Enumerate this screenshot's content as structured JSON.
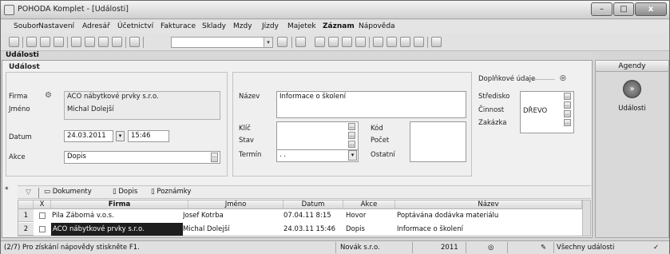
{
  "window": {
    "title": "POHODA Komplet - [Události]",
    "controls": {
      "minimize": "–",
      "maximize": "□",
      "close": "x"
    }
  },
  "menu": [
    "Soubor",
    "Nastavení",
    "Adresář",
    "Účetnictví",
    "Fakturace",
    "Sklady",
    "Mzdy",
    "Jízdy",
    "Majetek",
    "Záznam",
    "Nápověda"
  ],
  "panel": {
    "title": "Události"
  },
  "form": {
    "section_title": "Událost",
    "firma_label": "Firma",
    "firma_value": "ACO nábytkové prvky s.r.o.",
    "jmeno_label": "Jméno",
    "jmeno_value": "Michal Dolejší",
    "datum_label": "Datum",
    "datum_value": "24.03.2011",
    "cas_value": "15:46",
    "akce_label": "Akce",
    "akce_value": "Dopis",
    "nazev_label": "Název",
    "nazev_value": "Informace o školení",
    "klic_label": "Klíč",
    "stav_label": "Stav",
    "termin_label": "Termín",
    "termin_value": ". .",
    "kod_label": "Kód",
    "pocet_label": "Počet",
    "ostatni_label": "Ostatní",
    "doplnkove_label": "Doplňkové údaje",
    "stredisko_label": "Středisko",
    "cinnost_label": "Činnost",
    "cinnost_value": "DŘEVO",
    "zakazka_label": "Zakázka"
  },
  "tabs": [
    "Dokumenty",
    "Dopis",
    "Poznámky"
  ],
  "grid": {
    "columns": [
      "X",
      "Firma",
      "Jméno",
      "Datum",
      "Akce",
      "Název"
    ],
    "rows": [
      {
        "num": "1",
        "firma": "Pila Záborná v.o.s.",
        "jmeno": "Josef Kotrba",
        "datum": "07.04.11 8:15",
        "akce": "Hovor",
        "nazev": "Poptávána dodávka materiálu"
      },
      {
        "num": "2",
        "firma": "ACO nábytkové prvky s.r.o.",
        "jmeno": "Michal Dolejší",
        "datum": "24.03.11 15:46",
        "akce": "Dopis",
        "nazev": "Informace o školení"
      }
    ]
  },
  "status": {
    "help": "(2/7) Pro získání nápovědy stiskněte F1.",
    "company": "Novák s.r.o.",
    "year": "2011",
    "filter": "Všechny události"
  },
  "agenda": {
    "header": "Agendy",
    "item": "Události"
  },
  "colors": {
    "selected_row": "#1e1e1e",
    "selected_text": "#ffffff"
  }
}
